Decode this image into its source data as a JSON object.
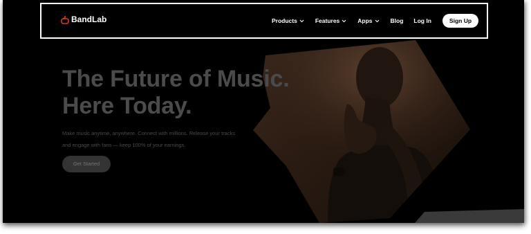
{
  "brand": {
    "name": "BandLab",
    "logo_icon": "bandlab-logo-icon",
    "accent_color": "#e8332a"
  },
  "nav": {
    "products": "Products",
    "features": "Features",
    "apps": "Apps",
    "blog": "Blog",
    "login": "Log In",
    "signup": "Sign Up",
    "dropdown_icon": "chevron-down-icon"
  },
  "hero": {
    "headline_line1": "The Future of Music.",
    "headline_line2": "Here Today.",
    "subtext_line1": "Make music anytime, anywhere. Connect with millions. Release your tracks",
    "subtext_line2": "and engage with fans — keep 100% of your earnings.",
    "cta": "Get Started",
    "image_subject": "woman with closed eyes touching her neck"
  },
  "colors": {
    "background": "#000000",
    "headline": "#4b4b4b",
    "subtext": "#4a4a4a",
    "cta_background": "#333333",
    "highlight_outline": "#ffffff"
  }
}
